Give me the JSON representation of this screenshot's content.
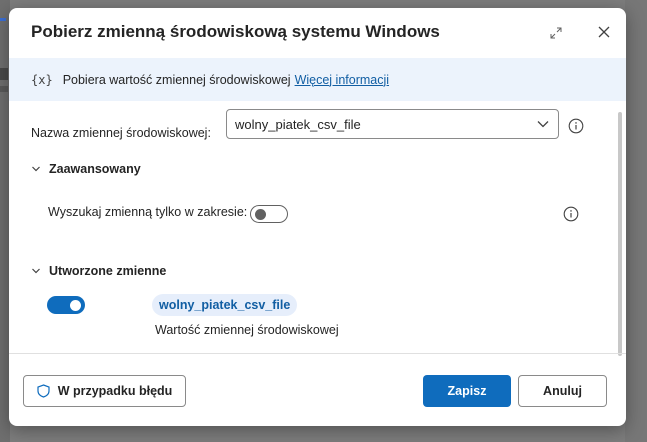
{
  "dialog": {
    "title": "Pobierz zmienną środowiskową systemu Windows",
    "info_icon_text": "{x}",
    "info_text": "Pobiera wartość zmiennej środowiskowej",
    "info_link": "Więcej informacji"
  },
  "form": {
    "env_var_label": "Nazwa zmiennej środowiskowej:",
    "env_var_value": "wolny_piatek_csv_file"
  },
  "advanced": {
    "header": "Zaawansowany",
    "scope_label": "Wyszukaj zmienną tylko w zakresie:",
    "scope_toggle": false
  },
  "created_vars": {
    "header": "Utworzone zmienne",
    "toggle": true,
    "variable_name": "wolny_piatek_csv_file",
    "variable_desc": "Wartość zmiennej środowiskowej"
  },
  "footer": {
    "on_error_label": "W przypadku błędu",
    "save_label": "Zapisz",
    "cancel_label": "Anuluj"
  },
  "colors": {
    "accent": "#0f6cbd",
    "info_bar": "#ecf3fc",
    "chip_bg": "#e6eefb"
  }
}
